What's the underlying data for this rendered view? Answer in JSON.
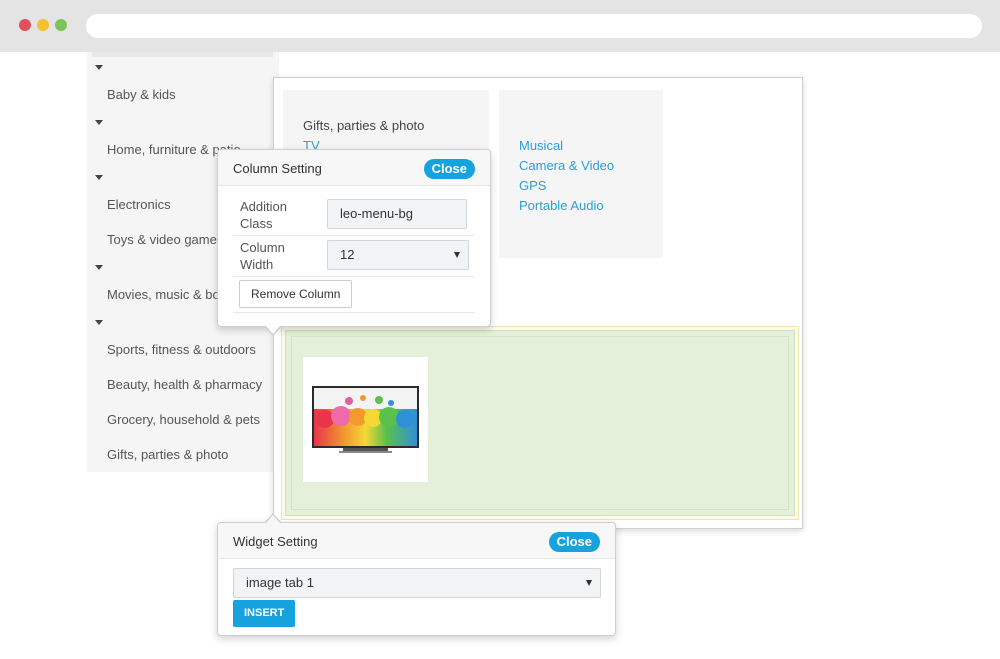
{
  "browser": {
    "dots": [
      "red",
      "yellow",
      "green"
    ]
  },
  "sidebar": {
    "items": [
      {
        "label": "Baby & kids",
        "caret": true
      },
      {
        "label": "Home, furniture & patio",
        "caret": true
      },
      {
        "label": "Electronics",
        "caret": true
      },
      {
        "label": "Toys & video games",
        "caret": false
      },
      {
        "label": "Movies, music & books",
        "caret": true
      },
      {
        "label": "Sports, fitness & outdoors",
        "caret": true
      },
      {
        "label": "Beauty, health & pharmacy",
        "caret": false
      },
      {
        "label": "Grocery, household & pets",
        "caret": false
      },
      {
        "label": "Gifts, parties & photo",
        "caret": false
      }
    ]
  },
  "mega_menu": {
    "column1": {
      "title": "Gifts, parties & photo",
      "links": [
        "TV"
      ]
    },
    "column2": {
      "links": [
        "Musical",
        "Camera & Video",
        "GPS",
        "Portable Audio"
      ]
    },
    "image_widget": {
      "icon": "tv-image"
    }
  },
  "column_setting": {
    "title": "Column Setting",
    "close_label": "Close",
    "addition_class_label": "Addition Class",
    "addition_class_value": "leo-menu-bg",
    "column_width_label": "Column Width",
    "column_width_value": "12",
    "remove_label": "Remove Column"
  },
  "widget_setting": {
    "title": "Widget Setting",
    "close_label": "Close",
    "widget_value": "image tab 1",
    "insert_label": "INSERT"
  },
  "colors": {
    "accent": "#15a2dd",
    "link": "#2aa0d8",
    "row_bg": "#e4f0d9"
  }
}
